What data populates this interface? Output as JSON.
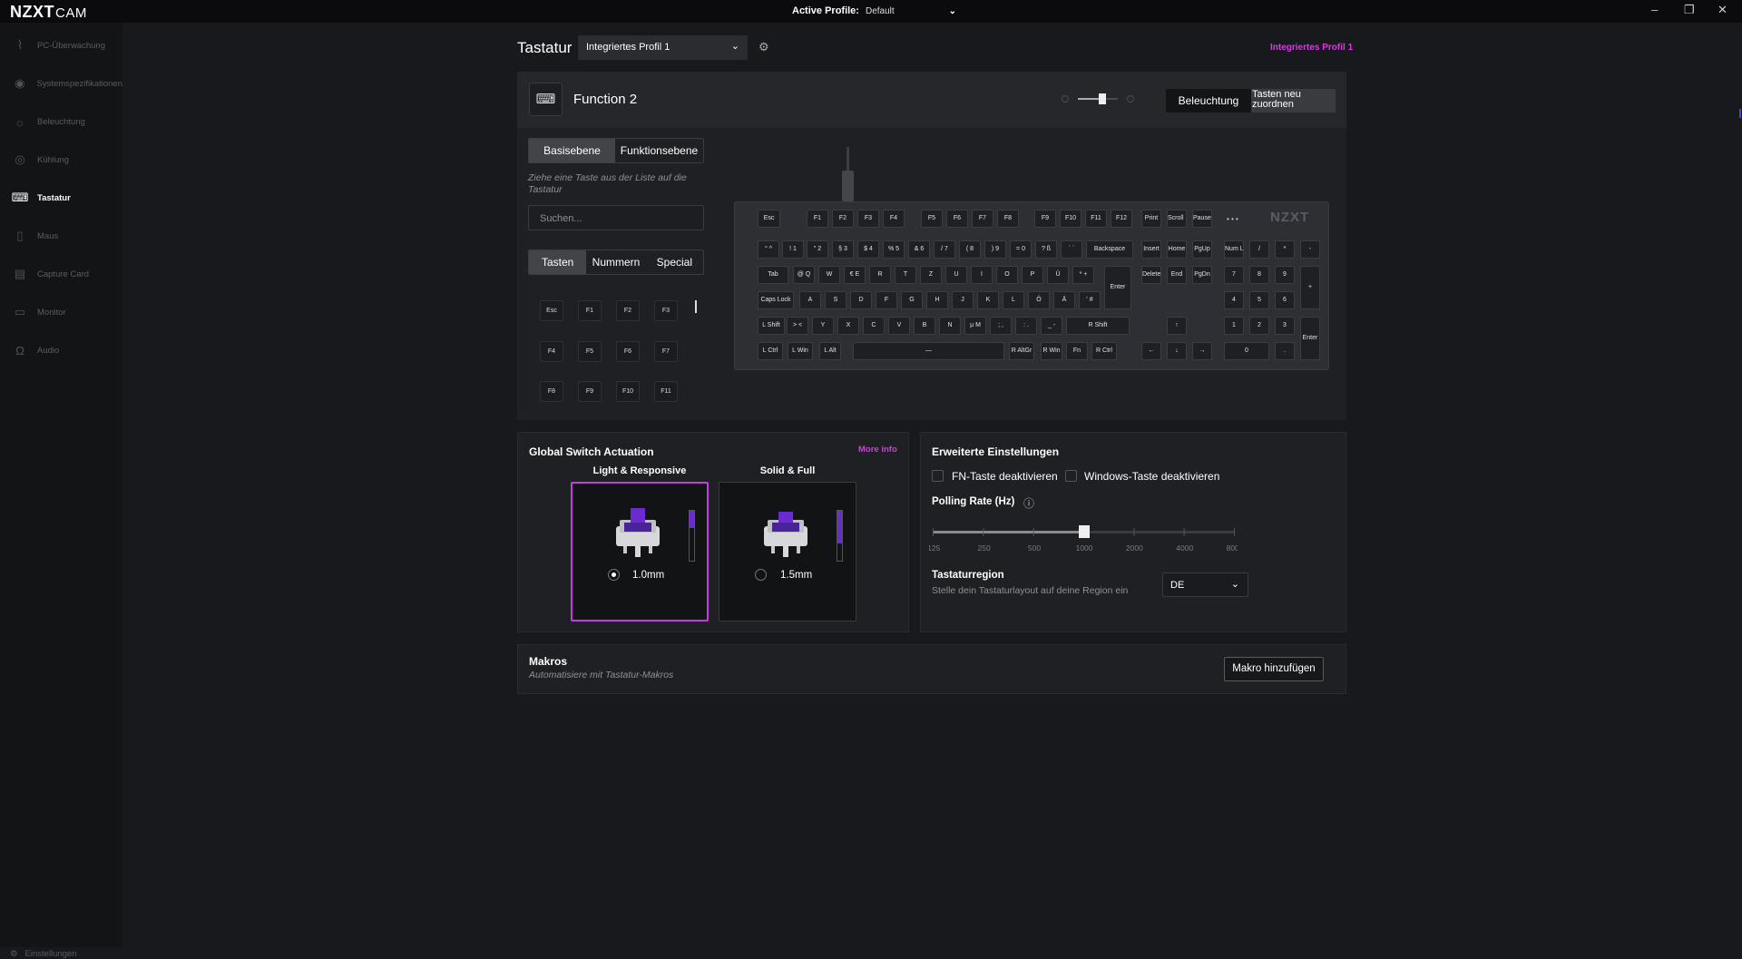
{
  "titlebar": {
    "logo_main": "NZXT",
    "logo_sub": "CAM",
    "active_profile_label": "Active Profile:",
    "active_profile_value": "Default",
    "minimize": "–",
    "restore": "❐",
    "close": "✕"
  },
  "sidebar": {
    "items": [
      {
        "label": "PC-Überwachung",
        "icon": "chart-line-icon",
        "glyph": "⌇"
      },
      {
        "label": "Systemspezifikationen",
        "icon": "eye-icon",
        "glyph": "◉"
      },
      {
        "label": "Beleuchtung",
        "icon": "sun-icon",
        "glyph": "☼"
      },
      {
        "label": "Kühlung",
        "icon": "fan-icon",
        "glyph": "◎"
      },
      {
        "label": "Tastatur",
        "icon": "keyboard-icon",
        "glyph": "⌨"
      },
      {
        "label": "Maus",
        "icon": "mouse-icon",
        "glyph": "▯"
      },
      {
        "label": "Capture Card",
        "icon": "capture-card-icon",
        "glyph": "▤"
      },
      {
        "label": "Monitor",
        "icon": "monitor-icon",
        "glyph": "▭"
      },
      {
        "label": "Audio",
        "icon": "headset-icon",
        "glyph": "Ω"
      }
    ],
    "settings_label": "Einstellungen",
    "settings_glyph": "⚙"
  },
  "page": {
    "title": "Tastatur",
    "profile_select": "Integriertes Profil 1",
    "profile_right": "Integriertes Profil 1",
    "chevron": "⌄",
    "gear": "⚙"
  },
  "keyboard_panel": {
    "layer_title": "Function 2",
    "fn_icon_glyph": "⌨",
    "lighting_btn": "Beleuchtung",
    "remap_btn": "Tasten neu zuordnen",
    "layer_tabs": [
      "Basisebene",
      "Funktionsebene"
    ],
    "hint": "Ziehe eine Taste aus der Liste auf die Tastatur",
    "search_placeholder": "Suchen...",
    "key_tabs": [
      "Tasten",
      "Nummern",
      "Special"
    ],
    "key_list": [
      "Esc",
      "F1",
      "F2",
      "F3",
      "F4",
      "F5",
      "F6",
      "F7",
      "F8",
      "F9",
      "F10",
      "F11"
    ],
    "brand": "NZXT",
    "dots": "• • •"
  },
  "keys": {
    "row0": [
      "Esc",
      "F1",
      "F2",
      "F3",
      "F4",
      "F5",
      "F6",
      "F7",
      "F8",
      "F9",
      "F10",
      "F11",
      "F12",
      "Print",
      "Scroll Lock",
      "Pause Break"
    ],
    "row1": [
      "° ^",
      "! 1",
      "\" 2",
      "§ 3",
      "$ 4",
      "% 5",
      "& 6",
      "/ 7",
      "( 8",
      ") 9",
      "= 0",
      "? ß",
      "` ´",
      "Backspace",
      "Insert",
      "Home",
      "PgUp",
      "Num Lock",
      "/",
      "*",
      "-"
    ],
    "row2": [
      "Tab",
      "@ Q",
      "W",
      "€ E",
      "R",
      "T",
      "Z",
      "U",
      "I",
      "O",
      "P",
      "Ü",
      "* +",
      "Delete",
      "End",
      "PgDn",
      "7",
      "8",
      "9",
      "+"
    ],
    "row3": [
      "Caps Lock",
      "A",
      "S",
      "D",
      "F",
      "G",
      "H",
      "J",
      "K",
      "L",
      "Ö",
      "Ä",
      "' #",
      "Enter",
      "4",
      "5",
      "6"
    ],
    "row4": [
      "L Shift",
      "> <",
      "Y",
      "X",
      "C",
      "V",
      "B",
      "N",
      "µ M",
      "; ,",
      ": .",
      "_ -",
      "R Shift",
      "↑",
      "1",
      "2",
      "3",
      "Enter"
    ],
    "row5": [
      "L Ctrl",
      "L Win",
      "L Alt",
      "—",
      "R AltGr",
      "R Win",
      "Fn",
      "R Ctrl",
      "←",
      "↓",
      "→",
      "0",
      "."
    ]
  },
  "actuation": {
    "title": "Global Switch Actuation",
    "more_info": "More info",
    "options": [
      {
        "label": "Light & Responsive",
        "value": "1.0mm",
        "selected": true,
        "level": 0.35
      },
      {
        "label": "Solid & Full",
        "value": "1.5mm",
        "selected": false,
        "level": 0.65
      }
    ]
  },
  "extended": {
    "title": "Erweiterte Einstellungen",
    "fn_disable": "FN-Taste deaktivieren",
    "win_disable": "Windows-Taste deaktivieren",
    "polling_label": "Polling Rate (Hz)",
    "info_glyph": "ⓘ",
    "polling_ticks": [
      "125",
      "250",
      "500",
      "1000",
      "2000",
      "4000",
      "8000"
    ],
    "polling_value": "1000",
    "region_title": "Tastaturregion",
    "region_desc": "Stelle dein Tastaturlayout auf deine Region ein",
    "region_value": "DE"
  },
  "macros": {
    "title": "Makros",
    "subtitle": "Automatisiere mit Tastatur-Makros",
    "add_btn": "Makro hinzufügen"
  },
  "colors": {
    "accent": "#c23ce0",
    "bg": "#18191c",
    "panel": "#1f2024",
    "purple": "#6a2bd1"
  }
}
